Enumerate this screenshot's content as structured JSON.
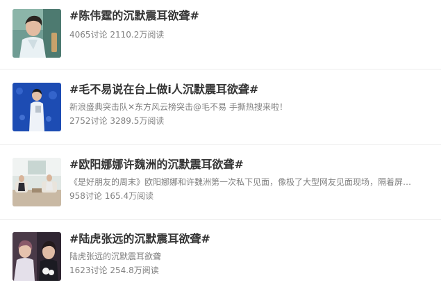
{
  "topics": [
    {
      "title": "#陈伟霆的沉默震耳欲聋#",
      "description": "",
      "stats": "4065讨论 2110.2万阅读",
      "thumb_bg": "#7fa8a0"
    },
    {
      "title": "#毛不易说在台上做i人沉默震耳欲聋#",
      "description": "新浪盛典突击队✕东方风云榜突击@毛不易 手撕热搜来啦！",
      "stats": "2752讨论 3289.5万阅读",
      "thumb_bg": "#1f4fb8"
    },
    {
      "title": "#欧阳娜娜许魏洲的沉默震耳欲聋#",
      "description": "《是好朋友的周末》欧阳娜娜和许魏洲第一次私下见面，像极了大型网友见面现场，隔着屏…",
      "stats": "958讨论 165.4万阅读",
      "thumb_bg": "#d9e3e0"
    },
    {
      "title": "#陆虎张远的沉默震耳欲聋#",
      "description": "陆虎张远的沉默震耳欲聋",
      "stats": "1623讨论 254.8万阅读",
      "thumb_bg": "#3a2e3a"
    }
  ]
}
